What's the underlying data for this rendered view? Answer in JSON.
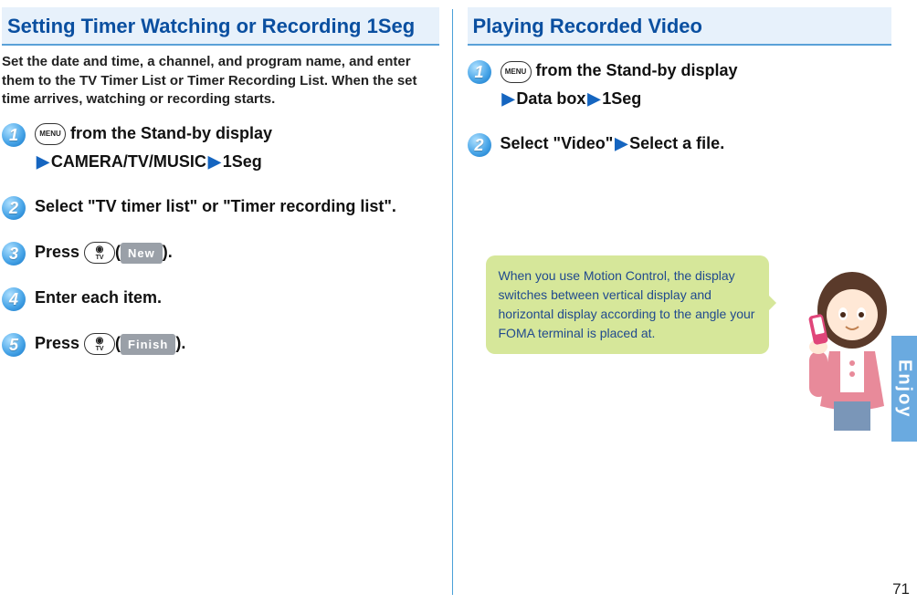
{
  "left": {
    "heading": "Setting Timer Watching or Recording 1Seg",
    "intro": "Set the date and time, a channel, and program name, and enter them to the TV Timer List or Timer Recording List. When the set time arrives, watching or recording starts.",
    "steps": {
      "s1": {
        "num": "1",
        "icon_label": "MENU",
        "line1_after": " from the Stand-by display",
        "line2_a": "CAMERA/TV/MUSIC",
        "line2_b": "1Seg"
      },
      "s2": {
        "num": "2",
        "text": "Select \"TV timer list\" or \"Timer recording list\"."
      },
      "s3": {
        "num": "3",
        "prefix": "Press ",
        "btn_tv": "TV",
        "softkey": "New",
        "suffix": ")."
      },
      "s4": {
        "num": "4",
        "text": "Enter each item."
      },
      "s5": {
        "num": "5",
        "prefix": "Press ",
        "btn_tv": "TV",
        "softkey": "Finish",
        "suffix": ")."
      }
    }
  },
  "right": {
    "heading": "Playing Recorded Video",
    "steps": {
      "s1": {
        "num": "1",
        "icon_label": "MENU",
        "line1_after": " from the Stand-by display",
        "line2_a": "Data box",
        "line2_b": "1Seg"
      },
      "s2": {
        "num": "2",
        "part_a": "Select \"Video\"",
        "part_b": "Select a file."
      }
    },
    "tip": "When you use Motion Control, the display switches between vertical display and horizontal display according to the angle your FOMA terminal is placed at."
  },
  "side_label": "Enjoy",
  "page_number": "71"
}
